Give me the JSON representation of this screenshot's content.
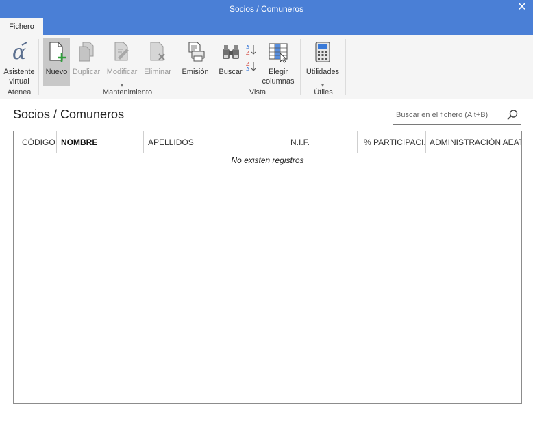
{
  "window": {
    "title": "Socios / Comuneros",
    "close_glyph": "✕"
  },
  "tabs": [
    {
      "label": "Fichero"
    }
  ],
  "ribbon": {
    "atenea": {
      "assistant_label_1": "Asistente",
      "assistant_label_2": "virtual",
      "group_label": "Atenea"
    },
    "mantenimiento": {
      "nuevo": "Nuevo",
      "duplicar": "Duplicar",
      "modificar": "Modificar",
      "eliminar": "Eliminar",
      "emision": "Emisión",
      "group_label": "Mantenimiento"
    },
    "vista": {
      "buscar": "Buscar",
      "elegir_1": "Elegir",
      "elegir_2": "columnas",
      "group_label": "Vista"
    },
    "utiles": {
      "utilidades": "Utilidades",
      "group_label": "Útiles"
    }
  },
  "main": {
    "heading": "Socios / Comuneros",
    "search": {
      "placeholder": "Buscar en el fichero (Alt+B)"
    },
    "table": {
      "columns": [
        "CÓDIGO",
        "NOMBRE",
        "APELLIDOS",
        "N.I.F.",
        "% PARTICIPACI...",
        "ADMINISTRACIÓN AEAT"
      ],
      "empty_message": "No existen registros"
    }
  },
  "colors": {
    "titlebar": "#4a7fd6",
    "ribbon_bg": "#f5f5f5",
    "new_plus": "#2e9e3a"
  }
}
